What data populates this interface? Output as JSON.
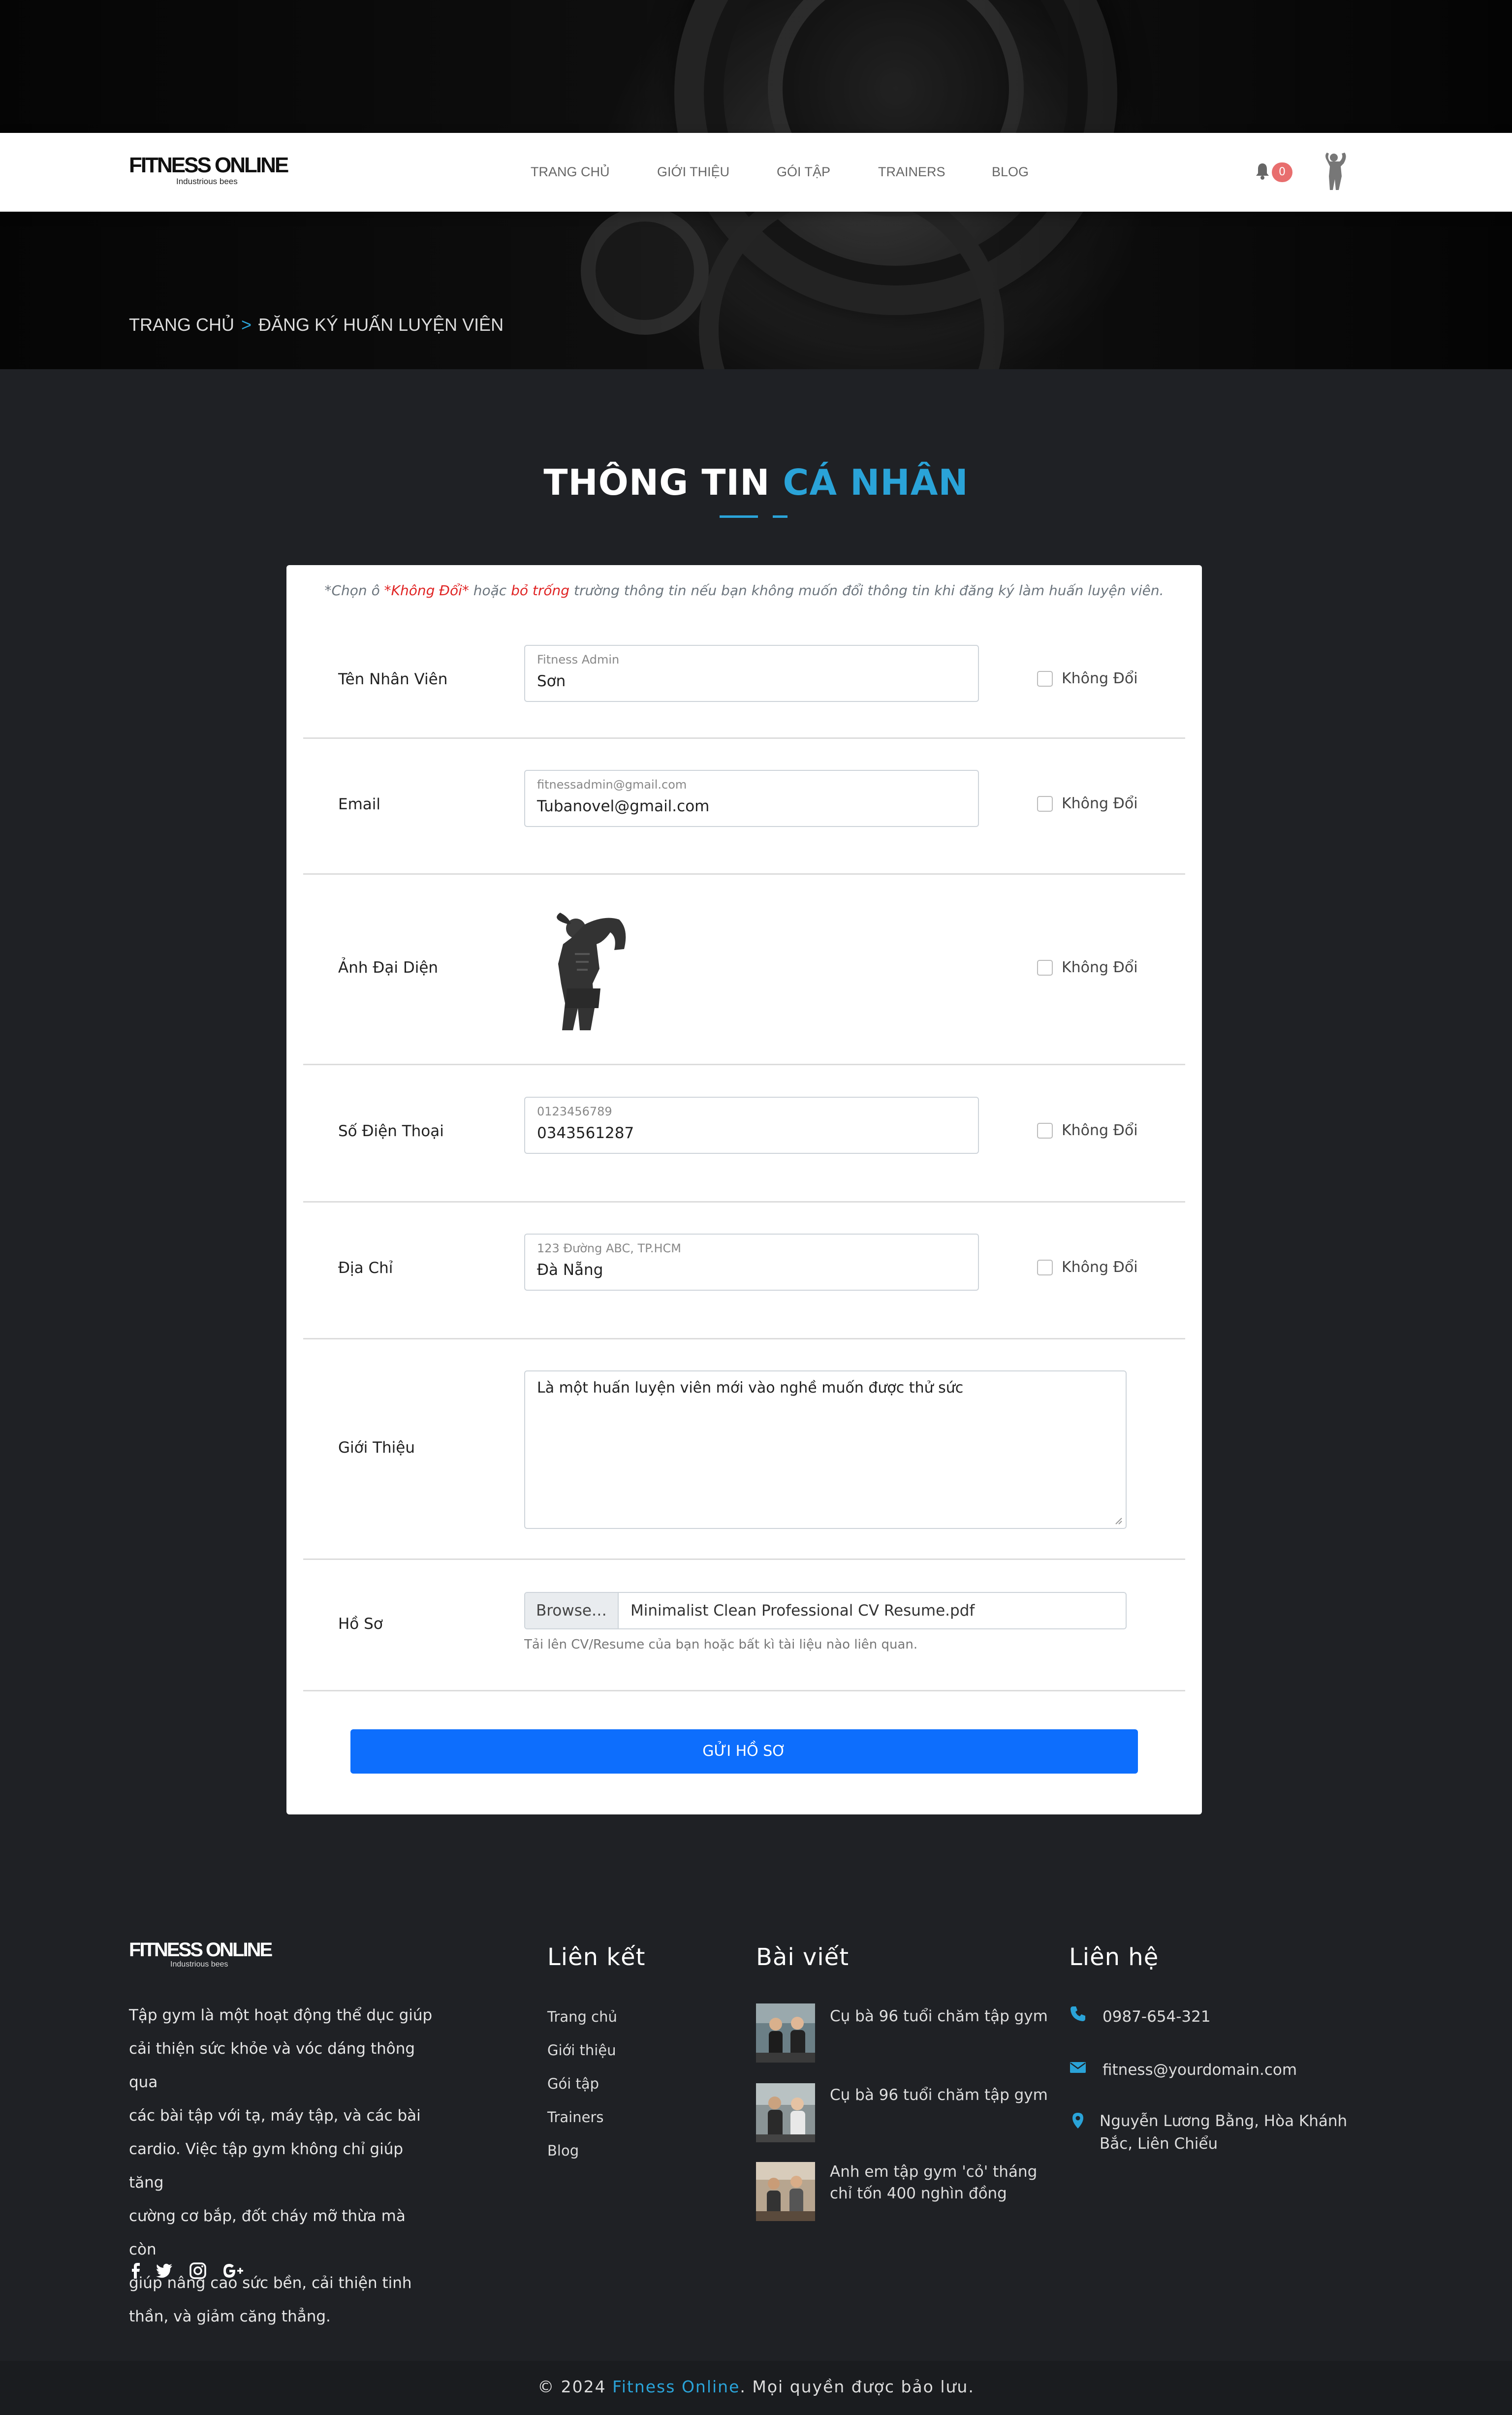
{
  "header": {
    "logo_brand": "FITNESS ONLINE",
    "logo_tagline": "Industrious bees",
    "nav": [
      "TRANG CHỦ",
      "GIỚI THIỆU",
      "GÓI TẬP",
      "TRAINERS",
      "BLOG"
    ],
    "notification_count": "0",
    "bell_icon": "bell-icon",
    "avatar_icon": "user-avatar-icon"
  },
  "breadcrumb": {
    "home": "TRANG CHỦ",
    "separator": ">",
    "current": "ĐĂNG KÝ HUẤN LUYỆN VIÊN"
  },
  "section": {
    "title_main": "THÔNG TIN ",
    "title_accent": "CÁ NHÂN"
  },
  "form": {
    "note_prefix": "*Chọn ô ",
    "note_keep": "*Không Đổi*",
    "note_middle": " hoặc ",
    "note_empty": "bỏ trống",
    "note_suffix": " trường thông tin nếu bạn không muốn đổi thông tin khi đăng ký làm huấn luyện viên.",
    "keep_label": "Không Đổi",
    "name": {
      "label": "Tên Nhân Viên",
      "placeholder": "Fitness Admin",
      "value": "Sơn"
    },
    "email": {
      "label": "Email",
      "placeholder": "fitnessadmin@gmail.com",
      "value": "Tubanovel@gmail.com"
    },
    "avatar": {
      "label": "Ảnh Đại Diện",
      "image_icon": "bodybuilder-photo"
    },
    "phone": {
      "label": "Số Điện Thoại",
      "placeholder": "0123456789",
      "value": "0343561287"
    },
    "address": {
      "label": "Địa Chỉ",
      "placeholder": "123 Đường ABC, TP.HCM",
      "value": "Đà Nẵng"
    },
    "intro": {
      "label": "Giới Thiệu",
      "value": "Là một huấn luyện viên mới vào nghề muốn được thử sức"
    },
    "resume": {
      "label": "Hồ Sơ",
      "browse_label": "Browse…",
      "file_name": "Minimalist Clean Professional CV Resume.pdf",
      "help": "Tải lên CV/Resume của bạn hoặc bất kì tài liệu nào liên quan."
    },
    "submit_label": "GỬI HỒ SƠ"
  },
  "footer": {
    "logo_brand": "FITNESS ONLINE",
    "logo_tagline": "Industrious bees",
    "about_lines": [
      "Tập gym là một hoạt động thể dục giúp",
      "cải thiện sức khỏe và vóc dáng thông qua",
      "các bài tập với tạ, máy tập, và các bài",
      "cardio. Việc tập gym không chỉ giúp tăng",
      "cường cơ bắp, đốt cháy mỡ thừa mà còn",
      "giúp nâng cao sức bền, cải thiện tinh",
      "thần, và giảm căng thẳng."
    ],
    "social_icons": [
      "facebook-icon",
      "twitter-icon",
      "instagram-icon",
      "google-plus-icon"
    ],
    "links_heading": "Liên kết",
    "links": [
      "Trang chủ",
      "Giới thiệu",
      "Gói tập",
      "Trainers",
      "Blog"
    ],
    "posts_heading": "Bài viết",
    "posts": [
      {
        "title": "Cụ bà 96 tuổi chăm tập gym"
      },
      {
        "title": "Cụ bà 96 tuổi chăm tập gym"
      },
      {
        "title": "Anh em tập gym 'cỏ' tháng chỉ tốn 400 nghìn đồng"
      }
    ],
    "contact_heading": "Liên hệ",
    "contact": {
      "phone": "0987-654-321",
      "email": "fitness@yourdomain.com",
      "address": "Nguyễn Lương Bằng, Hòa Khánh Bắc, Liên Chiểu"
    },
    "copyright_prefix": "© 2024 ",
    "copyright_brand": "Fitness Online",
    "copyright_suffix": ". Mọi quyền được bảo lưu."
  },
  "colors": {
    "accent": "#2aa3d8",
    "primary_button": "#0d6efd",
    "page_background": "#1f2125",
    "warning_text": "#e02424",
    "badge": "#e86e6e"
  }
}
